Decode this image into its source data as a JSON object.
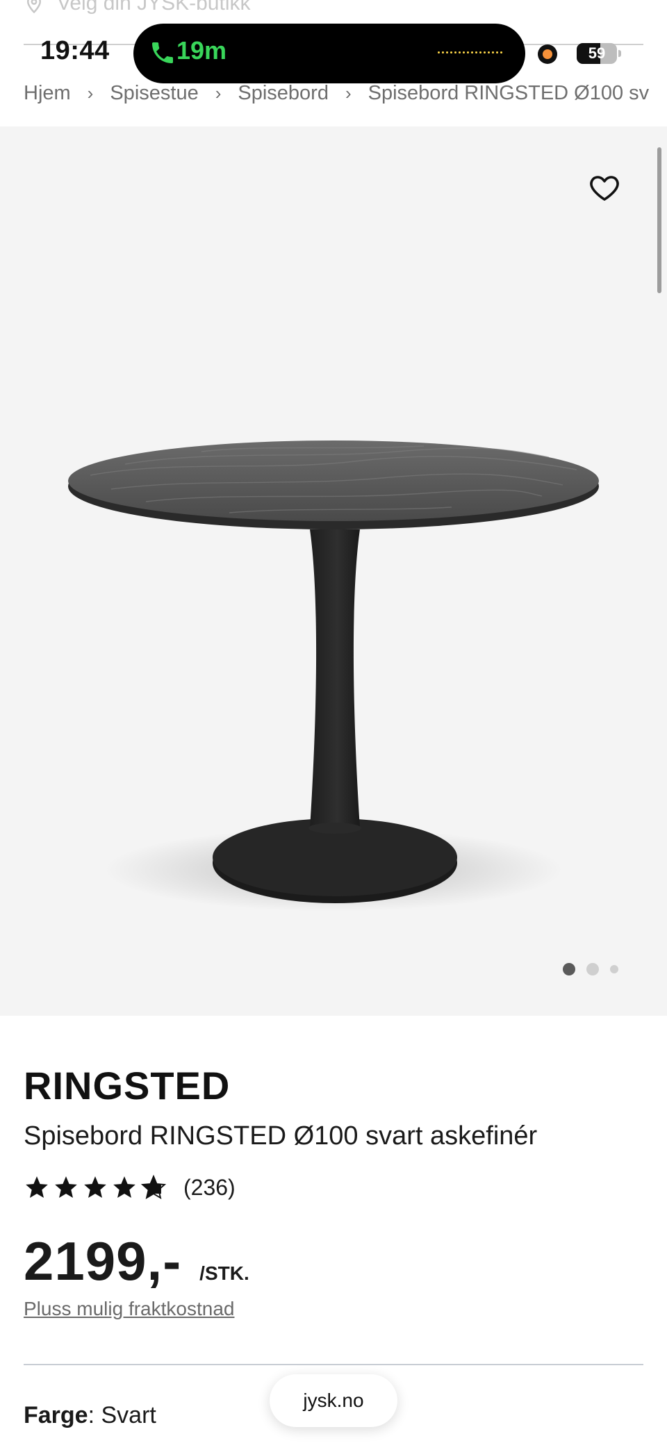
{
  "status_bar": {
    "time": "19:44",
    "call_duration": "19m",
    "battery": "59",
    "battery_level": 0.59
  },
  "store_selector": {
    "label": "Velg din JYSK-butikk"
  },
  "breadcrumb": {
    "items": [
      "Hjem",
      "Spisestue",
      "Spisebord",
      "Spisebord RINGSTED Ø100 sv"
    ]
  },
  "gallery": {
    "image_count": 3,
    "active_index": 0
  },
  "product": {
    "brand": "RINGSTED",
    "name": "Spisebord RINGSTED Ø100 svart askefinér",
    "rating": 4.5,
    "review_count": "(236)",
    "price": "2199,-",
    "unit": "/STK.",
    "shipping_note": "Pluss mulig fraktkostnad",
    "color_label": "Farge",
    "color_separator": ":",
    "color_value": " Svart"
  },
  "browser": {
    "url": "jysk.no"
  },
  "colors": {
    "call_green": "#39d65a",
    "text": "#1a1a1a",
    "muted": "#6e6e6e",
    "gallery_bg": "#f4f4f4"
  },
  "icons": {
    "favorite": "heart-outline-icon",
    "location": "location-pin-icon",
    "call": "phone-icon",
    "star": "star-icon"
  }
}
